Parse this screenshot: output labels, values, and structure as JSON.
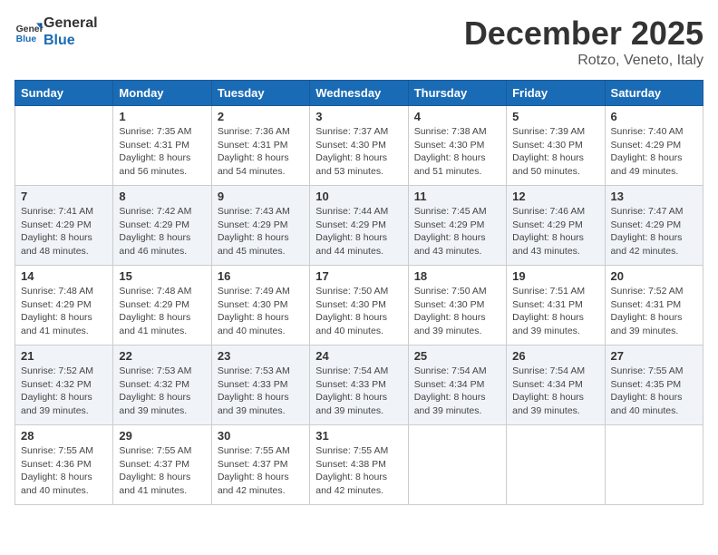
{
  "header": {
    "logo_line1": "General",
    "logo_line2": "Blue",
    "month_title": "December 2025",
    "subtitle": "Rotzo, Veneto, Italy"
  },
  "weekdays": [
    "Sunday",
    "Monday",
    "Tuesday",
    "Wednesday",
    "Thursday",
    "Friday",
    "Saturday"
  ],
  "weeks": [
    [
      {
        "day": "",
        "info": ""
      },
      {
        "day": "1",
        "info": "Sunrise: 7:35 AM\nSunset: 4:31 PM\nDaylight: 8 hours\nand 56 minutes."
      },
      {
        "day": "2",
        "info": "Sunrise: 7:36 AM\nSunset: 4:31 PM\nDaylight: 8 hours\nand 54 minutes."
      },
      {
        "day": "3",
        "info": "Sunrise: 7:37 AM\nSunset: 4:30 PM\nDaylight: 8 hours\nand 53 minutes."
      },
      {
        "day": "4",
        "info": "Sunrise: 7:38 AM\nSunset: 4:30 PM\nDaylight: 8 hours\nand 51 minutes."
      },
      {
        "day": "5",
        "info": "Sunrise: 7:39 AM\nSunset: 4:30 PM\nDaylight: 8 hours\nand 50 minutes."
      },
      {
        "day": "6",
        "info": "Sunrise: 7:40 AM\nSunset: 4:29 PM\nDaylight: 8 hours\nand 49 minutes."
      }
    ],
    [
      {
        "day": "7",
        "info": "Sunrise: 7:41 AM\nSunset: 4:29 PM\nDaylight: 8 hours\nand 48 minutes."
      },
      {
        "day": "8",
        "info": "Sunrise: 7:42 AM\nSunset: 4:29 PM\nDaylight: 8 hours\nand 46 minutes."
      },
      {
        "day": "9",
        "info": "Sunrise: 7:43 AM\nSunset: 4:29 PM\nDaylight: 8 hours\nand 45 minutes."
      },
      {
        "day": "10",
        "info": "Sunrise: 7:44 AM\nSunset: 4:29 PM\nDaylight: 8 hours\nand 44 minutes."
      },
      {
        "day": "11",
        "info": "Sunrise: 7:45 AM\nSunset: 4:29 PM\nDaylight: 8 hours\nand 43 minutes."
      },
      {
        "day": "12",
        "info": "Sunrise: 7:46 AM\nSunset: 4:29 PM\nDaylight: 8 hours\nand 43 minutes."
      },
      {
        "day": "13",
        "info": "Sunrise: 7:47 AM\nSunset: 4:29 PM\nDaylight: 8 hours\nand 42 minutes."
      }
    ],
    [
      {
        "day": "14",
        "info": "Sunrise: 7:48 AM\nSunset: 4:29 PM\nDaylight: 8 hours\nand 41 minutes."
      },
      {
        "day": "15",
        "info": "Sunrise: 7:48 AM\nSunset: 4:29 PM\nDaylight: 8 hours\nand 41 minutes."
      },
      {
        "day": "16",
        "info": "Sunrise: 7:49 AM\nSunset: 4:30 PM\nDaylight: 8 hours\nand 40 minutes."
      },
      {
        "day": "17",
        "info": "Sunrise: 7:50 AM\nSunset: 4:30 PM\nDaylight: 8 hours\nand 40 minutes."
      },
      {
        "day": "18",
        "info": "Sunrise: 7:50 AM\nSunset: 4:30 PM\nDaylight: 8 hours\nand 39 minutes."
      },
      {
        "day": "19",
        "info": "Sunrise: 7:51 AM\nSunset: 4:31 PM\nDaylight: 8 hours\nand 39 minutes."
      },
      {
        "day": "20",
        "info": "Sunrise: 7:52 AM\nSunset: 4:31 PM\nDaylight: 8 hours\nand 39 minutes."
      }
    ],
    [
      {
        "day": "21",
        "info": "Sunrise: 7:52 AM\nSunset: 4:32 PM\nDaylight: 8 hours\nand 39 minutes."
      },
      {
        "day": "22",
        "info": "Sunrise: 7:53 AM\nSunset: 4:32 PM\nDaylight: 8 hours\nand 39 minutes."
      },
      {
        "day": "23",
        "info": "Sunrise: 7:53 AM\nSunset: 4:33 PM\nDaylight: 8 hours\nand 39 minutes."
      },
      {
        "day": "24",
        "info": "Sunrise: 7:54 AM\nSunset: 4:33 PM\nDaylight: 8 hours\nand 39 minutes."
      },
      {
        "day": "25",
        "info": "Sunrise: 7:54 AM\nSunset: 4:34 PM\nDaylight: 8 hours\nand 39 minutes."
      },
      {
        "day": "26",
        "info": "Sunrise: 7:54 AM\nSunset: 4:34 PM\nDaylight: 8 hours\nand 39 minutes."
      },
      {
        "day": "27",
        "info": "Sunrise: 7:55 AM\nSunset: 4:35 PM\nDaylight: 8 hours\nand 40 minutes."
      }
    ],
    [
      {
        "day": "28",
        "info": "Sunrise: 7:55 AM\nSunset: 4:36 PM\nDaylight: 8 hours\nand 40 minutes."
      },
      {
        "day": "29",
        "info": "Sunrise: 7:55 AM\nSunset: 4:37 PM\nDaylight: 8 hours\nand 41 minutes."
      },
      {
        "day": "30",
        "info": "Sunrise: 7:55 AM\nSunset: 4:37 PM\nDaylight: 8 hours\nand 42 minutes."
      },
      {
        "day": "31",
        "info": "Sunrise: 7:55 AM\nSunset: 4:38 PM\nDaylight: 8 hours\nand 42 minutes."
      },
      {
        "day": "",
        "info": ""
      },
      {
        "day": "",
        "info": ""
      },
      {
        "day": "",
        "info": ""
      }
    ]
  ]
}
